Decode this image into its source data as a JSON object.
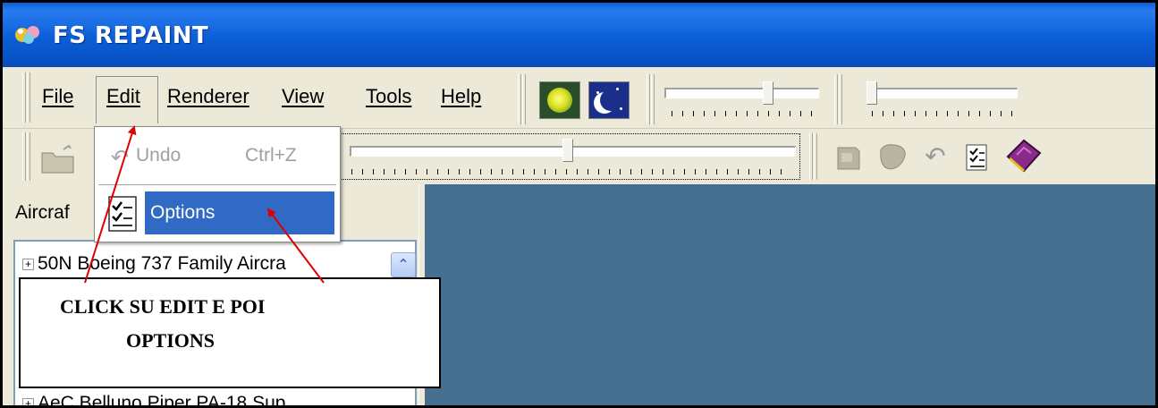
{
  "app": {
    "title": "FS REPAINT"
  },
  "menubar": {
    "items": [
      {
        "label": "File"
      },
      {
        "label": "Edit"
      },
      {
        "label": "Renderer"
      },
      {
        "label": "View"
      },
      {
        "label": "Tools"
      },
      {
        "label": "Help"
      }
    ]
  },
  "edit_menu": {
    "undo": {
      "label": "Undo",
      "shortcut": "Ctrl+Z",
      "icon": "undo-icon",
      "enabled": false
    },
    "options": {
      "label": "Options",
      "icon": "options-icon",
      "highlighted": true,
      "highlight_color": "#316ac5"
    }
  },
  "toolbar": {
    "day_button_icon": "sun-icon",
    "night_button_icon": "moon-icon",
    "tools_icons": [
      "paint-icon",
      "palette-icon",
      "undo-icon",
      "options-icon",
      "book-icon"
    ]
  },
  "left_panel": {
    "label": "Aircraf",
    "tree": [
      {
        "label": "50N Boeing 737 Family Aircra",
        "expander": "+"
      },
      {
        "label": "AeC Belluno Piper PA-18 Sup",
        "expander": "+"
      }
    ]
  },
  "annotation": {
    "line1": "CLICK SU EDIT E POI",
    "line2": "OPTIONS",
    "arrow_color": "#e00000"
  },
  "colors": {
    "viewport_bg": "#466e8e",
    "titlebar": "#0a5fd8",
    "menu_bg": "#ece9d8"
  }
}
